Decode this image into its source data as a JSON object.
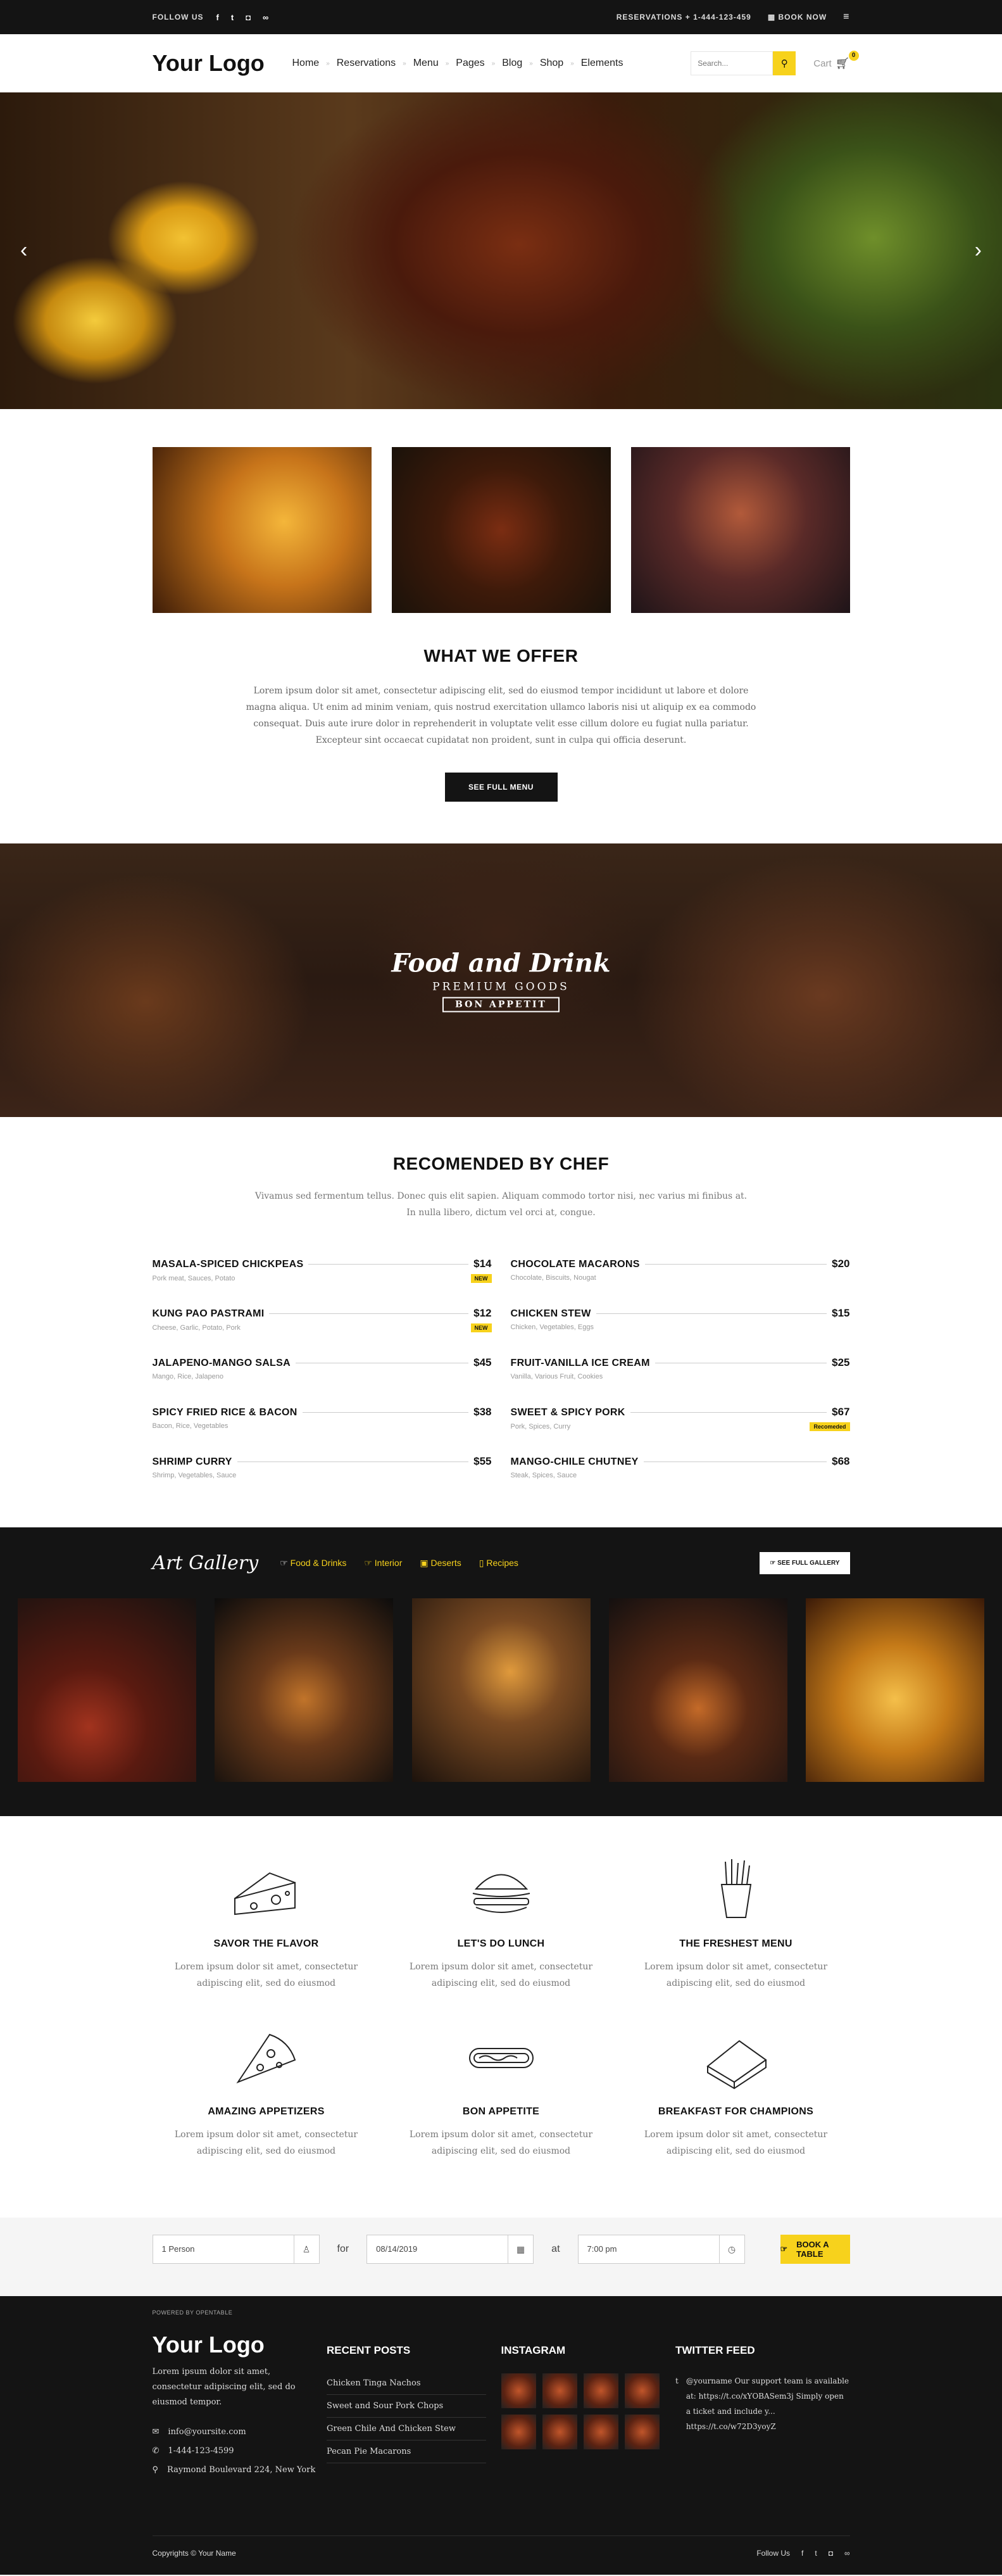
{
  "topbar": {
    "follow": "FOLLOW US",
    "reservations": "RESERVATIONS + 1-444-123-459",
    "book_now": "BOOK NOW"
  },
  "header": {
    "logo": "Your Logo",
    "nav": [
      "Home",
      "Reservations",
      "Menu",
      "Pages",
      "Blog",
      "Shop",
      "Elements"
    ],
    "search_placeholder": "Search...",
    "cart_label": "Cart",
    "cart_count": "0"
  },
  "offer": {
    "title": "WHAT WE OFFER",
    "text": "Lorem ipsum dolor sit amet, consectetur adipiscing elit, sed do eiusmod tempor incididunt ut labore et dolore magna aliqua. Ut enim ad minim veniam, quis nostrud exercitation ullamco laboris nisi ut aliquip ex ea commodo consequat. Duis aute irure dolor in reprehenderit in voluptate velit esse cillum dolore eu fugiat nulla pariatur. Excepteur sint occaecat cupidatat non proident, sunt in culpa qui officia deserunt.",
    "button": "SEE FULL MENU"
  },
  "banner": {
    "line1": "Food and Drink",
    "line2": "PREMIUM GOODS",
    "line3": "BON APPETIT"
  },
  "chef": {
    "title": "RECOMENDED BY CHEF",
    "text": "Vivamus sed fermentum tellus. Donec quis elit sapien. Aliquam commodo tortor nisi, nec varius mi finibus at. In nulla libero, dictum vel orci at, congue.",
    "left": [
      {
        "name": "MASALA-SPICED CHICKPEAS",
        "price": "$14",
        "ing": "Pork meat, Sauces, Potato",
        "tag": "NEW"
      },
      {
        "name": "KUNG PAO PASTRAMI",
        "price": "$12",
        "ing": "Cheese, Garlic, Potato, Pork",
        "tag": "NEW"
      },
      {
        "name": "JALAPENO-MANGO SALSA",
        "price": "$45",
        "ing": "Mango, Rice, Jalapeno",
        "tag": ""
      },
      {
        "name": "SPICY FRIED RICE & BACON",
        "price": "$38",
        "ing": "Bacon, Rice, Vegetables",
        "tag": ""
      },
      {
        "name": "SHRIMP CURRY",
        "price": "$55",
        "ing": "Shrimp, Vegetables, Sauce",
        "tag": ""
      }
    ],
    "right": [
      {
        "name": "CHOCOLATE MACARONS",
        "price": "$20",
        "ing": "Chocolate, Biscuits, Nougat",
        "tag": ""
      },
      {
        "name": "CHICKEN STEW",
        "price": "$15",
        "ing": "Chicken, Vegetables, Eggs",
        "tag": ""
      },
      {
        "name": "FRUIT-VANILLA ICE CREAM",
        "price": "$25",
        "ing": "Vanilla, Various Fruit, Cookies",
        "tag": ""
      },
      {
        "name": "SWEET & SPICY PORK",
        "price": "$67",
        "ing": "Pork, Spices, Curry",
        "tag": "Recomeded"
      },
      {
        "name": "MANGO-CHILE CHUTNEY",
        "price": "$68",
        "ing": "Steak, Spices, Sauce",
        "tag": ""
      }
    ]
  },
  "gallery": {
    "title": "Art Gallery",
    "tabs": [
      "Food & Drinks",
      "Interior",
      "Deserts",
      "Recipes"
    ],
    "button": "SEE FULL GALLERY"
  },
  "features": [
    {
      "name": "SAVOR THE FLAVOR",
      "desc": "Lorem ipsum dolor sit amet, consectetur adipiscing elit, sed do eiusmod",
      "icon": "cheese-icon"
    },
    {
      "name": "LET'S DO LUNCH",
      "desc": "Lorem ipsum dolor sit amet, consectetur adipiscing elit, sed do eiusmod",
      "icon": "burger-icon"
    },
    {
      "name": "THE FRESHEST MENU",
      "desc": "Lorem ipsum dolor sit amet, consectetur adipiscing elit, sed do eiusmod",
      "icon": "fries-icon"
    },
    {
      "name": "AMAZING APPETIZERS",
      "desc": "Lorem ipsum dolor sit amet, consectetur adipiscing elit, sed do eiusmod",
      "icon": "pizza-icon"
    },
    {
      "name": "BON APPETITE",
      "desc": "Lorem ipsum dolor sit amet, consectetur adipiscing elit, sed do eiusmod",
      "icon": "hotdog-icon"
    },
    {
      "name": "BREAKFAST FOR CHAMPIONS",
      "desc": "Lorem ipsum dolor sit amet, consectetur adipiscing elit, sed do eiusmod",
      "icon": "sandwich-icon"
    }
  ],
  "booking": {
    "persons": "1 Person",
    "for": "for",
    "date": "08/14/2019",
    "at": "at",
    "time": "7:00 pm",
    "button": "BOOK A TABLE",
    "powered": "POWERED BY OPENTABLE"
  },
  "footer": {
    "logo": "Your Logo",
    "text": "Lorem ipsum dolor sit amet, consectetur adipiscing elit, sed do eiusmod tempor.",
    "email": "info@yoursite.com",
    "phone": "1-444-123-4599",
    "address": "Raymond Boulevard 224, New York",
    "posts_title": "RECENT POSTS",
    "posts": [
      "Chicken Tinga Nachos",
      "Sweet and Sour Pork Chops",
      "Green Chile And Chicken Stew",
      "Pecan Pie Macarons"
    ],
    "insta_title": "INSTAGRAM",
    "twitter_title": "TWITTER FEED",
    "tweet": "@yourname Our support team is available at: https://t.co/xYOBASem3j Simply open a ticket and include y... https://t.co/w72D3yoyZ",
    "copyright": "Copyrights © Your Name",
    "follow": "Follow Us"
  },
  "colors": {
    "accent": "#f7d21c",
    "dark": "#141414"
  }
}
